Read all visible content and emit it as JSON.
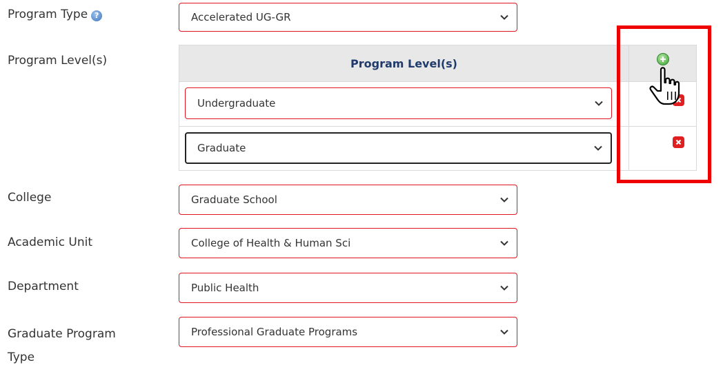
{
  "program_type": {
    "label": "Program Type",
    "help_icon": "question-circle-icon",
    "value": "Accelerated UG-GR"
  },
  "program_levels": {
    "label": "Program Level(s)",
    "table_header": "Program Level(s)",
    "rows": [
      {
        "value": "Undergraduate"
      },
      {
        "value": "Graduate"
      }
    ],
    "add_icon": "plus-circle-icon",
    "remove_icon": "x-circle-icon"
  },
  "college": {
    "label": "College",
    "value": "Graduate School"
  },
  "academic_unit": {
    "label": "Academic Unit",
    "value": "College of Health & Human Sci"
  },
  "department": {
    "label": "Department",
    "value": "Public Health"
  },
  "graduate_program_type": {
    "label_line1": "Graduate Program",
    "label_line2": "Type",
    "value": "Professional Graduate Programs"
  },
  "colors": {
    "required_border": "#e0141e",
    "header_text": "#1f3a6b",
    "highlight": "#ee0000",
    "add_green": "#3aa235"
  }
}
